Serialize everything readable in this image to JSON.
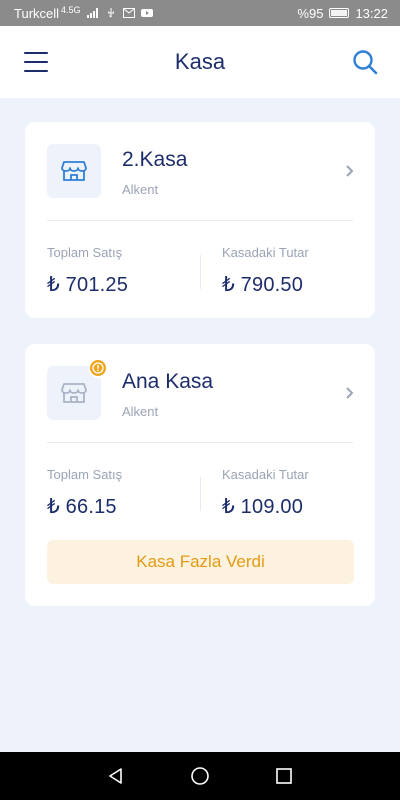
{
  "status_bar": {
    "carrier": "Turkcell",
    "network": "4.5G",
    "battery_percent": "%95",
    "battery_level": 0.95,
    "time": "13:22"
  },
  "app_bar": {
    "title": "Kasa",
    "icons": {
      "menu": "menu-icon",
      "search": "search-icon"
    }
  },
  "registers": [
    {
      "name": "2.Kasa",
      "location": "Alkent",
      "has_warning": false,
      "total_sales_label": "Toplam Satış",
      "total_sales": "₺ 701.25",
      "cash_amount_label": "Kasadaki Tutar",
      "cash_amount": "₺ 790.50"
    },
    {
      "name": "Ana Kasa",
      "location": "Alkent",
      "has_warning": true,
      "total_sales_label": "Toplam Satış",
      "total_sales": "₺ 66.15",
      "cash_amount_label": "Kasadaki Tutar",
      "cash_amount": "₺ 109.00",
      "alert": "Kasa Fazla Verdi"
    }
  ],
  "colors": {
    "primary": "#1d2d6b",
    "accent_blue": "#2f7fd6",
    "muted_text": "#9aa4b5",
    "background": "#eef3fb",
    "warning": "#f0a41c",
    "warning_bg": "#fdf1df",
    "status_bar": "#8b8b8b"
  },
  "nav_bar": {
    "back": "back-icon",
    "home": "home-icon",
    "recents": "recents-icon"
  }
}
